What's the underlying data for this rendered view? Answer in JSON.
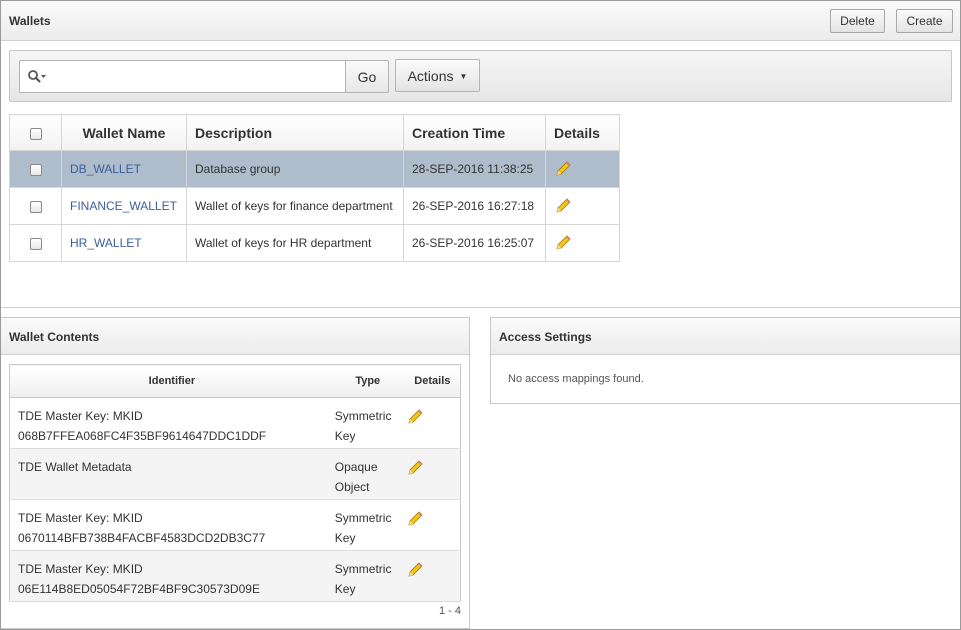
{
  "wallets": {
    "title": "Wallets",
    "delete_label": "Delete",
    "create_label": "Create",
    "search": {
      "value": "",
      "placeholder": ""
    },
    "go_label": "Go",
    "actions_label": "Actions",
    "columns": [
      "Wallet Name",
      "Description",
      "Creation Time",
      "Details"
    ],
    "rows": [
      {
        "name": "DB_WALLET",
        "description": "Database group",
        "created": "28-SEP-2016 11:38:25"
      },
      {
        "name": "FINANCE_WALLET",
        "description": "Wallet of keys for finance department",
        "created": "26-SEP-2016 16:27:18"
      },
      {
        "name": "HR_WALLET",
        "description": "Wallet of keys for HR department",
        "created": "26-SEP-2016 16:25:07"
      }
    ]
  },
  "contents": {
    "title": "Wallet Contents",
    "columns": [
      "Identifier",
      "Type",
      "Details"
    ],
    "rows": [
      {
        "id_line1": "TDE Master Key: MKID",
        "id_line2": "068B7FFEA068FC4F35BF9614647DDC1DDF",
        "type_line1": "Symmetric",
        "type_line2": "Key"
      },
      {
        "id_line1": "TDE Wallet Metadata",
        "id_line2": "",
        "type_line1": "Opaque",
        "type_line2": "Object"
      },
      {
        "id_line1": "TDE Master Key: MKID",
        "id_line2": "0670114BFB738B4FACBF4583DCD2DB3C77",
        "type_line1": "Symmetric",
        "type_line2": "Key"
      },
      {
        "id_line1": "TDE Master Key: MKID",
        "id_line2": "06E114B8ED05054F72BF4BF9C30573D09E",
        "type_line1": "Symmetric",
        "type_line2": "Key"
      }
    ],
    "pagination": "1 - 4"
  },
  "access": {
    "title": "Access Settings",
    "empty_message": "No access mappings found."
  },
  "colors": {
    "selected_row": "#aebccc",
    "link": "#3a5f98",
    "pencil": "#f2c51a"
  },
  "icons": [
    "search-icon",
    "chevron-down-icon",
    "pencil-icon"
  ]
}
